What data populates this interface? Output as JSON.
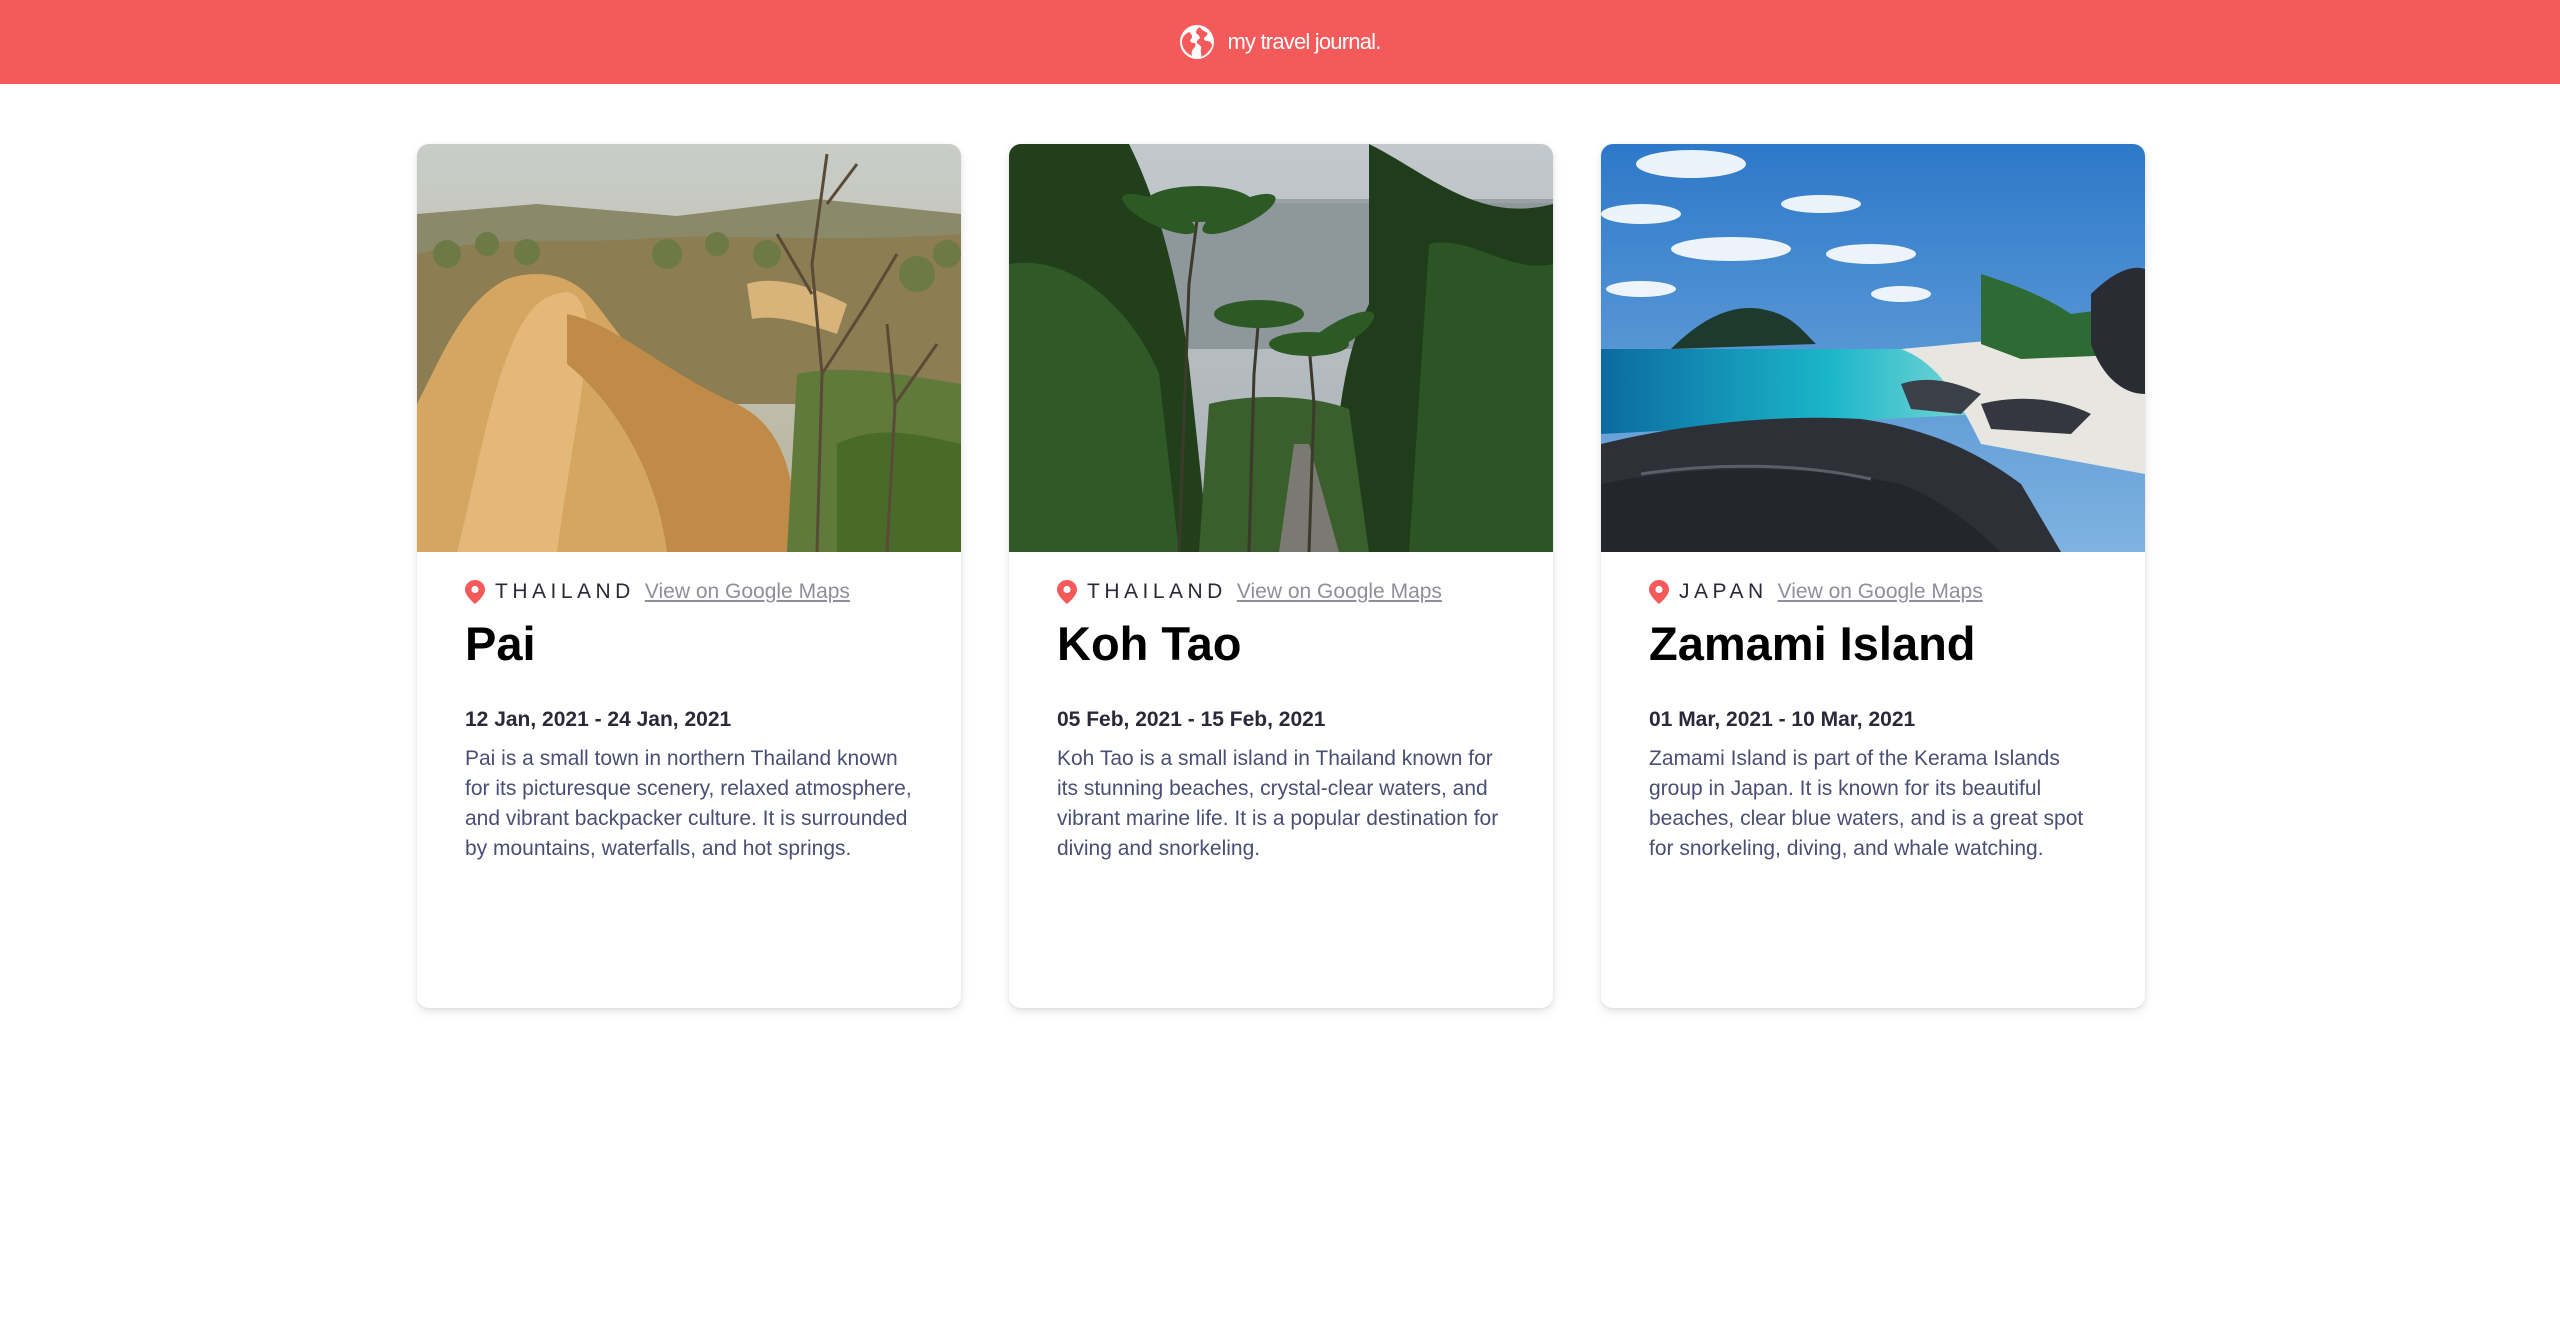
{
  "header": {
    "brand": "my travel journal.",
    "icon": "globe-icon",
    "background": "#F55A5A"
  },
  "entries": [
    {
      "country": "THAILAND",
      "map_link": "View on Google Maps",
      "title": "Pai",
      "dates": "12 Jan, 2021 - 24 Jan, 2021",
      "description": "Pai is a small town in northern Thailand known for its picturesque scenery, relaxed atmosphere, and vibrant backpacker culture. It is surrounded by mountains, waterfalls, and hot springs."
    },
    {
      "country": "THAILAND",
      "map_link": "View on Google Maps",
      "title": "Koh Tao",
      "dates": "05 Feb, 2021 - 15 Feb, 2021",
      "description": "Koh Tao is a small island in Thailand known for its stunning beaches, crystal-clear waters, and vibrant marine life. It is a popular destination for diving and snorkeling."
    },
    {
      "country": "JAPAN",
      "map_link": "View on Google Maps",
      "title": "Zamami Island",
      "dates": "01 Mar, 2021 - 10 Mar, 2021",
      "description": "Zamami Island is part of the Kerama Islands group in Japan. It is known for its beautiful beaches, clear blue waters, and is a great spot for snorkeling, diving, and whale watching."
    }
  ],
  "colors": {
    "accent": "#F55A5A",
    "link": "#918E9B",
    "text_dark": "#2B283A",
    "text_body": "#4A4E74"
  }
}
